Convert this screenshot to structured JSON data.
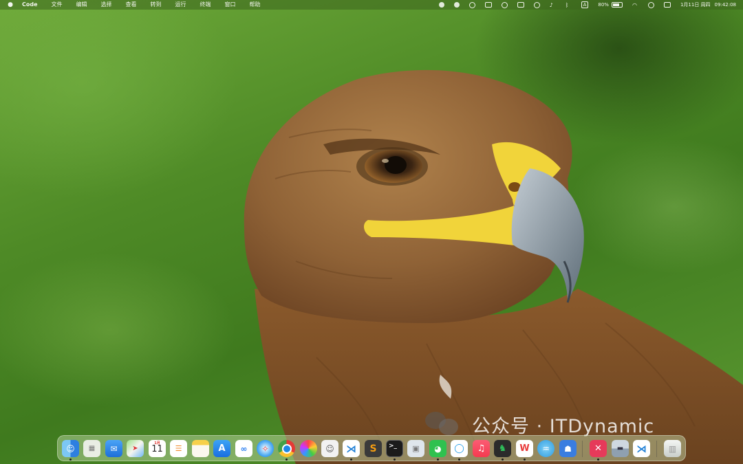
{
  "menubar": {
    "app_name": "Code",
    "menus": [
      "文件",
      "编辑",
      "选择",
      "查看",
      "转到",
      "运行",
      "终端",
      "窗口",
      "帮助"
    ],
    "status": {
      "input_source": "A",
      "battery_percent": "80%",
      "date": "1月11日 周四",
      "time": "09:42:08"
    }
  },
  "watermark": {
    "text": "公众号 · ITDynamic"
  },
  "dock": {
    "calendar": {
      "month": "1月",
      "day": "11"
    },
    "apps": [
      {
        "name": "finder-icon",
        "running": true
      },
      {
        "name": "launchpad-icon",
        "running": false
      },
      {
        "name": "mail-icon",
        "running": false
      },
      {
        "name": "maps-icon",
        "running": false
      },
      {
        "name": "calendar-icon",
        "running": false
      },
      {
        "name": "reminders-icon",
        "running": false
      },
      {
        "name": "notes-icon",
        "running": false
      },
      {
        "name": "app-store-icon",
        "running": false
      },
      {
        "name": "baidu-netdisk-icon",
        "running": false
      },
      {
        "name": "safari-icon",
        "running": false
      },
      {
        "name": "chrome-icon",
        "running": true
      },
      {
        "name": "color-wheel-icon",
        "running": false
      },
      {
        "name": "finder-face-icon",
        "running": false
      },
      {
        "name": "vscode-icon",
        "running": true
      },
      {
        "name": "sublime-text-icon",
        "running": false
      },
      {
        "name": "terminal-icon",
        "running": true
      },
      {
        "name": "preview-icon",
        "running": false
      },
      {
        "name": "wechat-icon",
        "running": true
      },
      {
        "name": "qq-chat-icon",
        "running": true
      },
      {
        "name": "music-icon",
        "running": false
      },
      {
        "name": "evernote-icon",
        "running": true
      },
      {
        "name": "wps-icon",
        "running": true
      },
      {
        "name": "fish-app-icon",
        "running": false
      },
      {
        "name": "cat-app-icon",
        "running": false
      },
      {
        "name": "xmind-icon",
        "running": true
      },
      {
        "name": "screen-capture-icon",
        "running": false
      },
      {
        "name": "vscode-insiders-icon",
        "running": false
      },
      {
        "name": "trash-icon",
        "running": false
      }
    ]
  },
  "colors": {
    "menubar_text": "#f2f5ee",
    "wallpaper_green": "#4e8a26",
    "eagle_brown": "#8a5a2e",
    "beak_yellow": "#f1d43a",
    "beak_gray": "#7f8f9c"
  }
}
